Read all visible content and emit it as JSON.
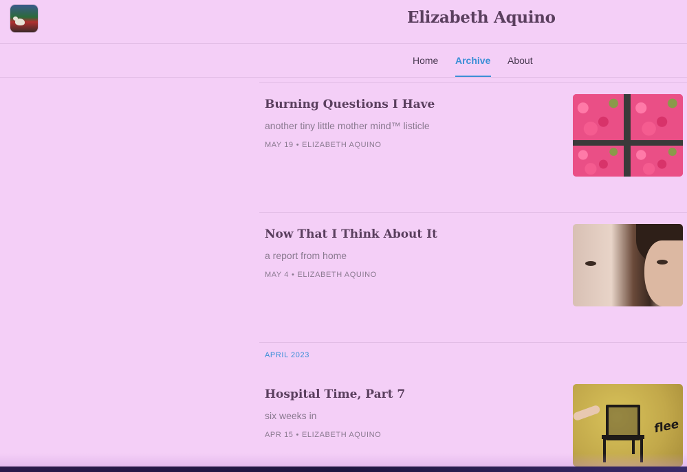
{
  "header": {
    "publication_title": "Elizabeth Aquino",
    "logo_icon": "publication-logo-icon"
  },
  "nav": {
    "tabs": [
      {
        "label": "Home",
        "active": false
      },
      {
        "label": "Archive",
        "active": true
      },
      {
        "label": "About",
        "active": false
      }
    ],
    "active_color": "#3b8fd6"
  },
  "archive": {
    "posts": [
      {
        "title": "Burning Questions I Have",
        "subtitle": "another tiny little mother mind™ listicle",
        "date": "MAY 19",
        "separator": "•",
        "author": "ELIZABETH AQUINO"
      },
      {
        "title": "Now That I Think About It",
        "subtitle": "a report from home",
        "date": "MAY 4",
        "separator": "•",
        "author": "ELIZABETH AQUINO"
      },
      {
        "title": "Hospital Time, Part 7",
        "subtitle": "six weeks in",
        "date": "APR 15",
        "separator": "•",
        "author": "ELIZABETH AQUINO",
        "thumbnail_text": "flee"
      }
    ],
    "month_heading": "APRIL 2023"
  },
  "colors": {
    "background": "#f4cff7",
    "title": "#5a3f5e",
    "muted": "#8a7a90",
    "accent": "#3b8fd6"
  }
}
